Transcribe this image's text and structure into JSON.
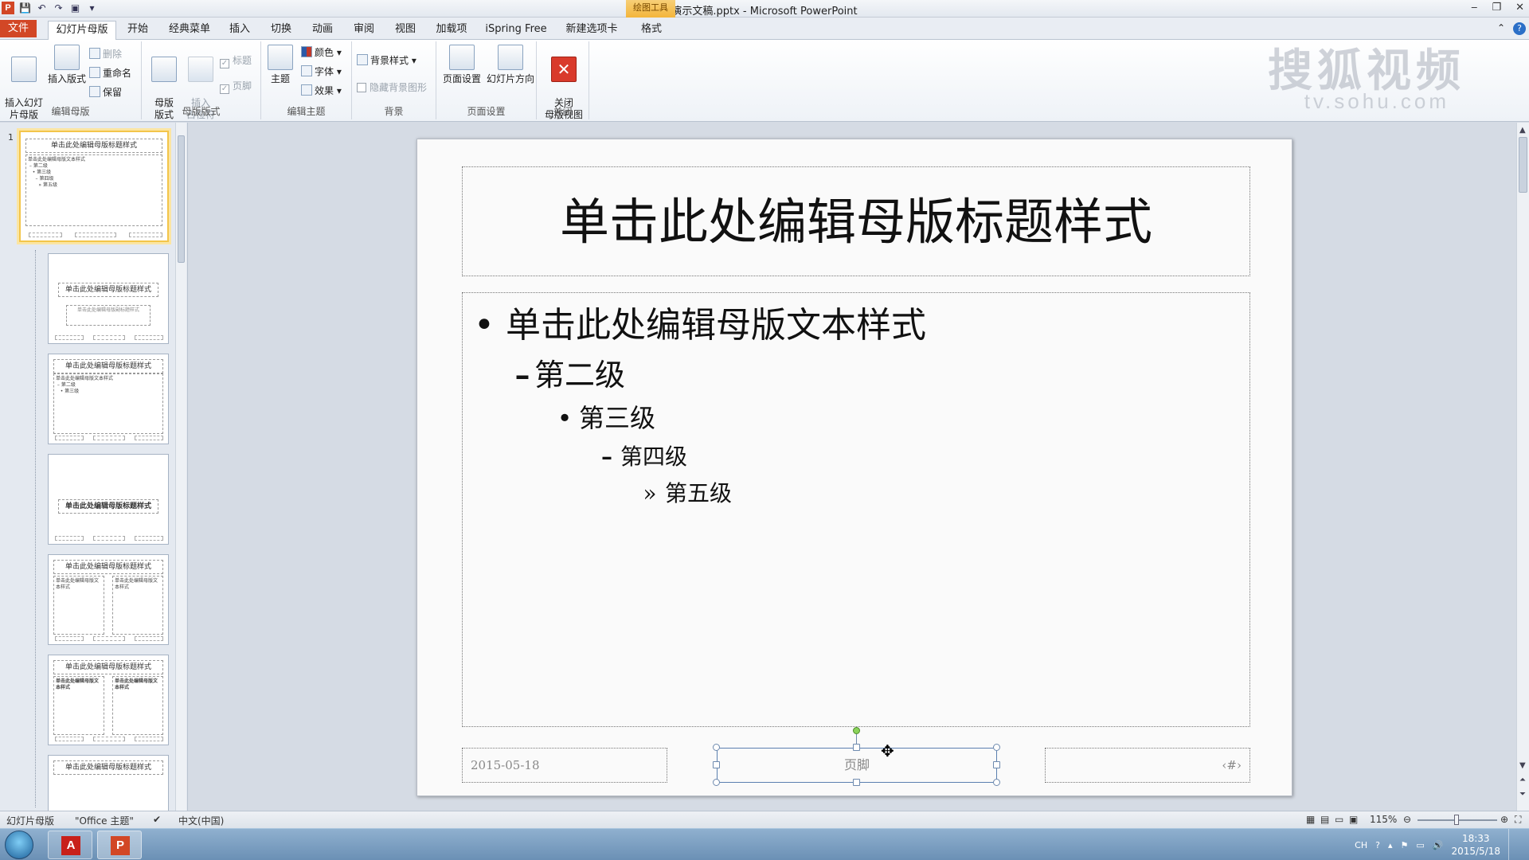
{
  "titlebar": {
    "title": "演示文稿.pptx - Microsoft PowerPoint",
    "context_tab": "绘图工具",
    "minimize": "‒",
    "restore": "❐",
    "close": "✕"
  },
  "tabs": {
    "file": "文件",
    "items": [
      "幻灯片母版",
      "开始",
      "经典菜单",
      "插入",
      "切换",
      "动画",
      "审阅",
      "视图",
      "加载项",
      "iSpring Free",
      "新建选项卡",
      "格式"
    ],
    "help": "?"
  },
  "ribbon": {
    "edit_master": {
      "label": "编辑母版",
      "insert_master": "插入幻灯\n片母版",
      "insert_layout": "插入版式",
      "delete": "删除",
      "rename": "重命名",
      "preserve": "保留"
    },
    "master_layout": {
      "label": "母版版式",
      "master_layout_btn": "母版\n版式",
      "insert_placeholder": "插入\n占位符",
      "title_chk": "标题",
      "footer_chk": "页脚"
    },
    "edit_theme": {
      "label": "编辑主题",
      "themes": "主题",
      "colors": "颜色",
      "fonts": "字体",
      "effects": "效果"
    },
    "background": {
      "label": "背景",
      "bg_styles": "背景样式",
      "hide_bg": "隐藏背景图形"
    },
    "page_setup": {
      "label": "页面设置",
      "page_setup_btn": "页面设置",
      "orientation": "幻灯片方向"
    },
    "close": {
      "label": "关闭",
      "close_master": "关闭\n母版视图"
    }
  },
  "watermark": {
    "line1": "搜狐视频",
    "line2": "tv.sohu.com"
  },
  "thumbnails": {
    "master_number": "1",
    "title_text": "单击此处编辑母版标题样式",
    "body_text": "单击此处编辑母版文本样式",
    "sub_text": "单击此处编辑母版副标题样式",
    "levels": [
      "第二级",
      "第三级",
      "第四级",
      "第五级"
    ]
  },
  "slide": {
    "title": "单击此处编辑母版标题样式",
    "body": {
      "level1": "单击此处编辑母版文本样式",
      "level2": "第二级",
      "level3": "第三级",
      "level4": "第四级",
      "level5": "第五级"
    },
    "bullets": {
      "l1": "•",
      "l2": "–",
      "l3": "•",
      "l4": "–",
      "l5": "»"
    },
    "date": "2015-05-18",
    "footer": "页脚",
    "number": "‹#›"
  },
  "status": {
    "view": "幻灯片母版",
    "theme": "\"Office 主题\"",
    "language": "中文(中国)",
    "zoom": "115%"
  },
  "taskbar": {
    "pdf_label": "A",
    "ppt_label": "P",
    "ime": "CH",
    "time": "18:33",
    "date": "2015/5/18"
  }
}
